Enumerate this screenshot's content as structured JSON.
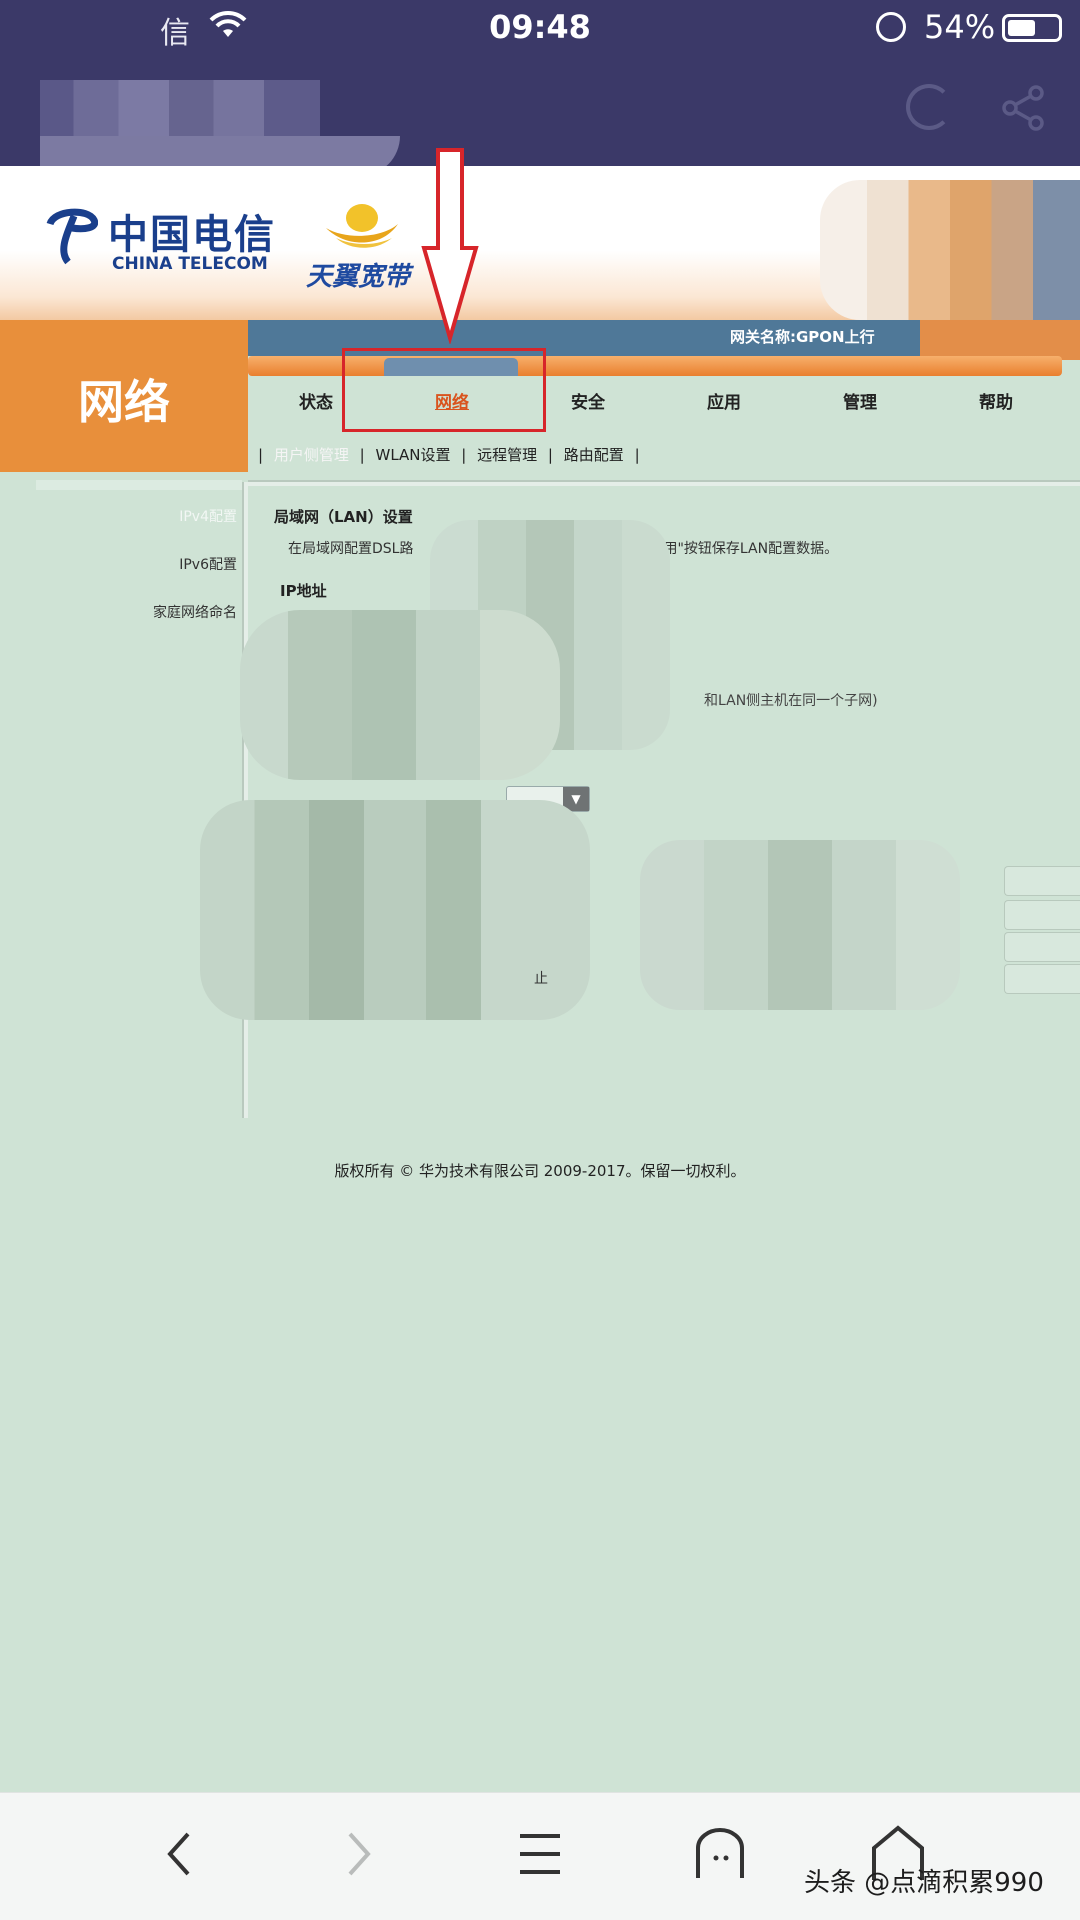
{
  "status_bar": {
    "carrier": "信",
    "time": "09:48",
    "battery": "54%",
    "battery_level": 0.54
  },
  "header": {
    "logo_cn": "中国电信",
    "logo_en": "CHINA TELECOM",
    "brand": "天翼宽带",
    "gateway_name": "网关名称:GPON上行"
  },
  "section_title": "网络",
  "nav": {
    "tabs": [
      "状态",
      "网络",
      "安全",
      "应用",
      "管理",
      "帮助"
    ],
    "active_index": 1,
    "subtabs": [
      "用户侧管理",
      "WLAN设置",
      "远程管理",
      "路由配置"
    ],
    "active_subtab": 0
  },
  "sidebar": {
    "items": [
      "IPv4配置",
      "IPv6配置",
      "家庭网络命名"
    ],
    "active_index": 0
  },
  "lan": {
    "title": "局域网（LAN）设置",
    "desc_start": "在局域网配置DSL路",
    "desc_end": "应用\"按钮保存LAN配置数据。",
    "ip_label": "IP地址",
    "subnet_hint": "和LAN侧主机在同一个子网)",
    "stop_char": "止"
  },
  "copyright": "版权所有 © 华为技术有限公司 2009-2017。保留一切权利。",
  "toolbar": {
    "back": "‹",
    "forward": "›",
    "menu": "☰",
    "watermark": "头条 @点滴积累990"
  },
  "colors": {
    "header_bg": "#3b3968",
    "section_orange": "#e88f3b",
    "page_bg": "#cfe3d5",
    "active_tab": "#d9541e",
    "highlight_red": "#d7252a"
  }
}
